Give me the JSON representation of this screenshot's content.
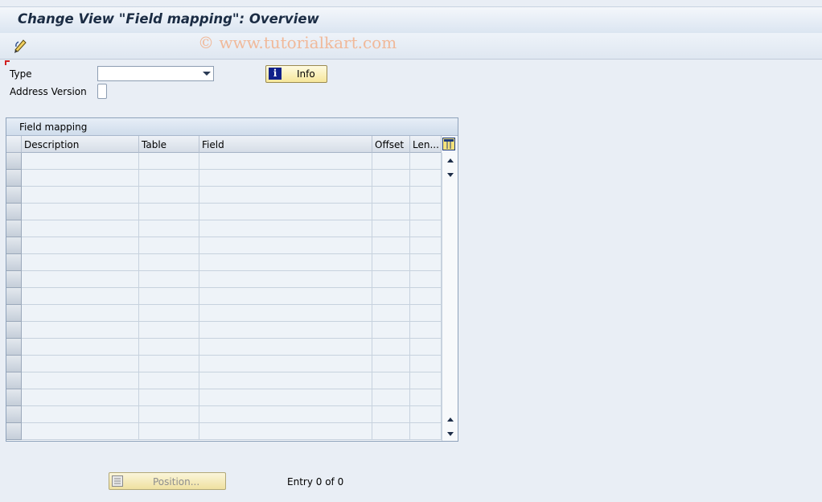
{
  "window": {
    "title": "Change View \"Field mapping\": Overview",
    "watermark": "© www.tutorialkart.com"
  },
  "toolbar": {
    "items": [
      {
        "icon": "display-change-icon"
      }
    ]
  },
  "form": {
    "type_label": "Type",
    "type_value": "",
    "address_version_label": "Address Version",
    "address_version_value": "",
    "info_button_label": "Info"
  },
  "table": {
    "title": "Field mapping",
    "columns": [
      "Description",
      "Table",
      "Field",
      "Offset",
      "Len..."
    ],
    "rows": []
  },
  "footer": {
    "position_button_label": "Position...",
    "entry_text": "Entry 0 of 0"
  },
  "colors": {
    "background": "#e9eef5",
    "button": "#f6e69a",
    "header": "#d6dde7"
  }
}
